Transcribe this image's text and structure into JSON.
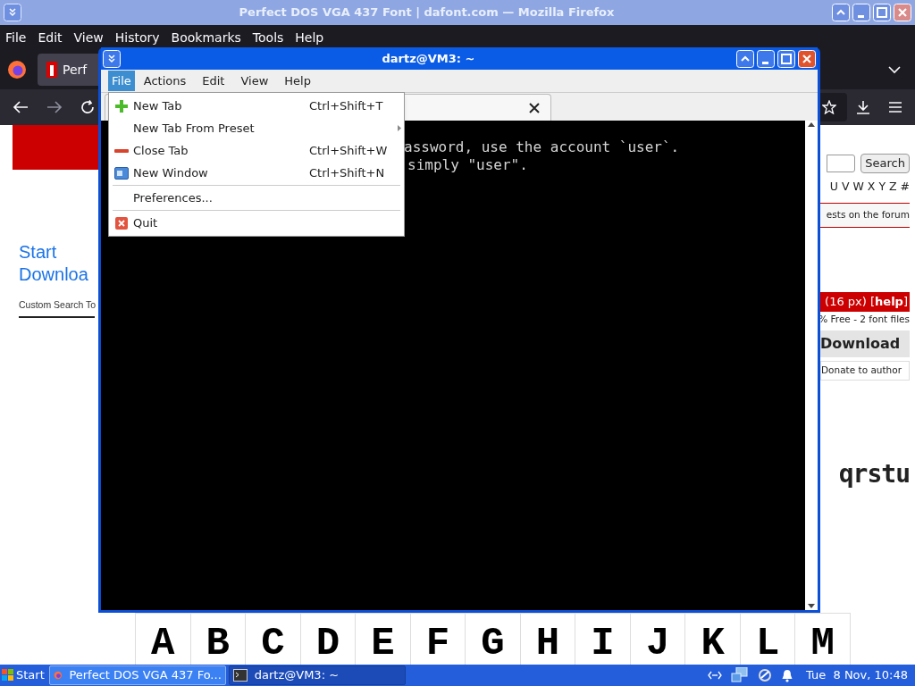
{
  "firefox": {
    "title": "Perfect DOS VGA 437 Font | dafont.com — Mozilla Firefox",
    "menu": [
      "File",
      "Edit",
      "View",
      "History",
      "Bookmarks",
      "Tools",
      "Help"
    ],
    "tab": {
      "label": "Perf"
    },
    "page": {
      "ad_lines": [
        "Start",
        "Downloa"
      ],
      "ad_link": "Custom Search To",
      "search_button": "Search",
      "alphabet": "U V W X Y Z #",
      "forum_note": "ests on the forum",
      "size_bar": "(16 px) [**help**]",
      "license": "% Free - 2 font files",
      "download": "Download",
      "donate": "Donate to author",
      "sample": "qrstu",
      "glyphs": [
        "A",
        "B",
        "C",
        "D",
        "E",
        "F",
        "G",
        "H",
        "I",
        "J",
        "K",
        "L",
        "M"
      ]
    }
  },
  "terminal": {
    "title": "dartz@VM3: ~",
    "menu": [
      {
        "label": "File",
        "selected": true
      },
      {
        "label": "Actions",
        "selected": false
      },
      {
        "label": "Edit",
        "selected": false
      },
      {
        "label": "View",
        "selected": false
      },
      {
        "label": "Help",
        "selected": false
      }
    ],
    "lines": [
      "assword, use the account `user`.",
      "simply \"user\"."
    ],
    "file_menu": [
      {
        "kind": "item",
        "label": "New Tab",
        "shortcut": "Ctrl+Shift+T",
        "submenu": false
      },
      {
        "kind": "item",
        "label": "New Tab From Preset",
        "submenu": true
      },
      {
        "kind": "item",
        "label": "Close Tab",
        "shortcut": "Ctrl+Shift+W",
        "submenu": false
      },
      {
        "kind": "item",
        "label": "New Window",
        "shortcut": "Ctrl+Shift+N",
        "submenu": false
      },
      {
        "kind": "separator"
      },
      {
        "kind": "item",
        "label": "Preferences...",
        "submenu": false
      },
      {
        "kind": "separator"
      },
      {
        "kind": "item",
        "label": "Quit",
        "submenu": false
      }
    ]
  },
  "taskbar": {
    "start": "Start",
    "tasks": [
      {
        "label": "Perfect DOS VGA 437 Fo...",
        "selected": false
      },
      {
        "label": "dartz@VM3: ~",
        "selected": true
      }
    ],
    "clock": "Tue  8 Nov, 10:48"
  }
}
